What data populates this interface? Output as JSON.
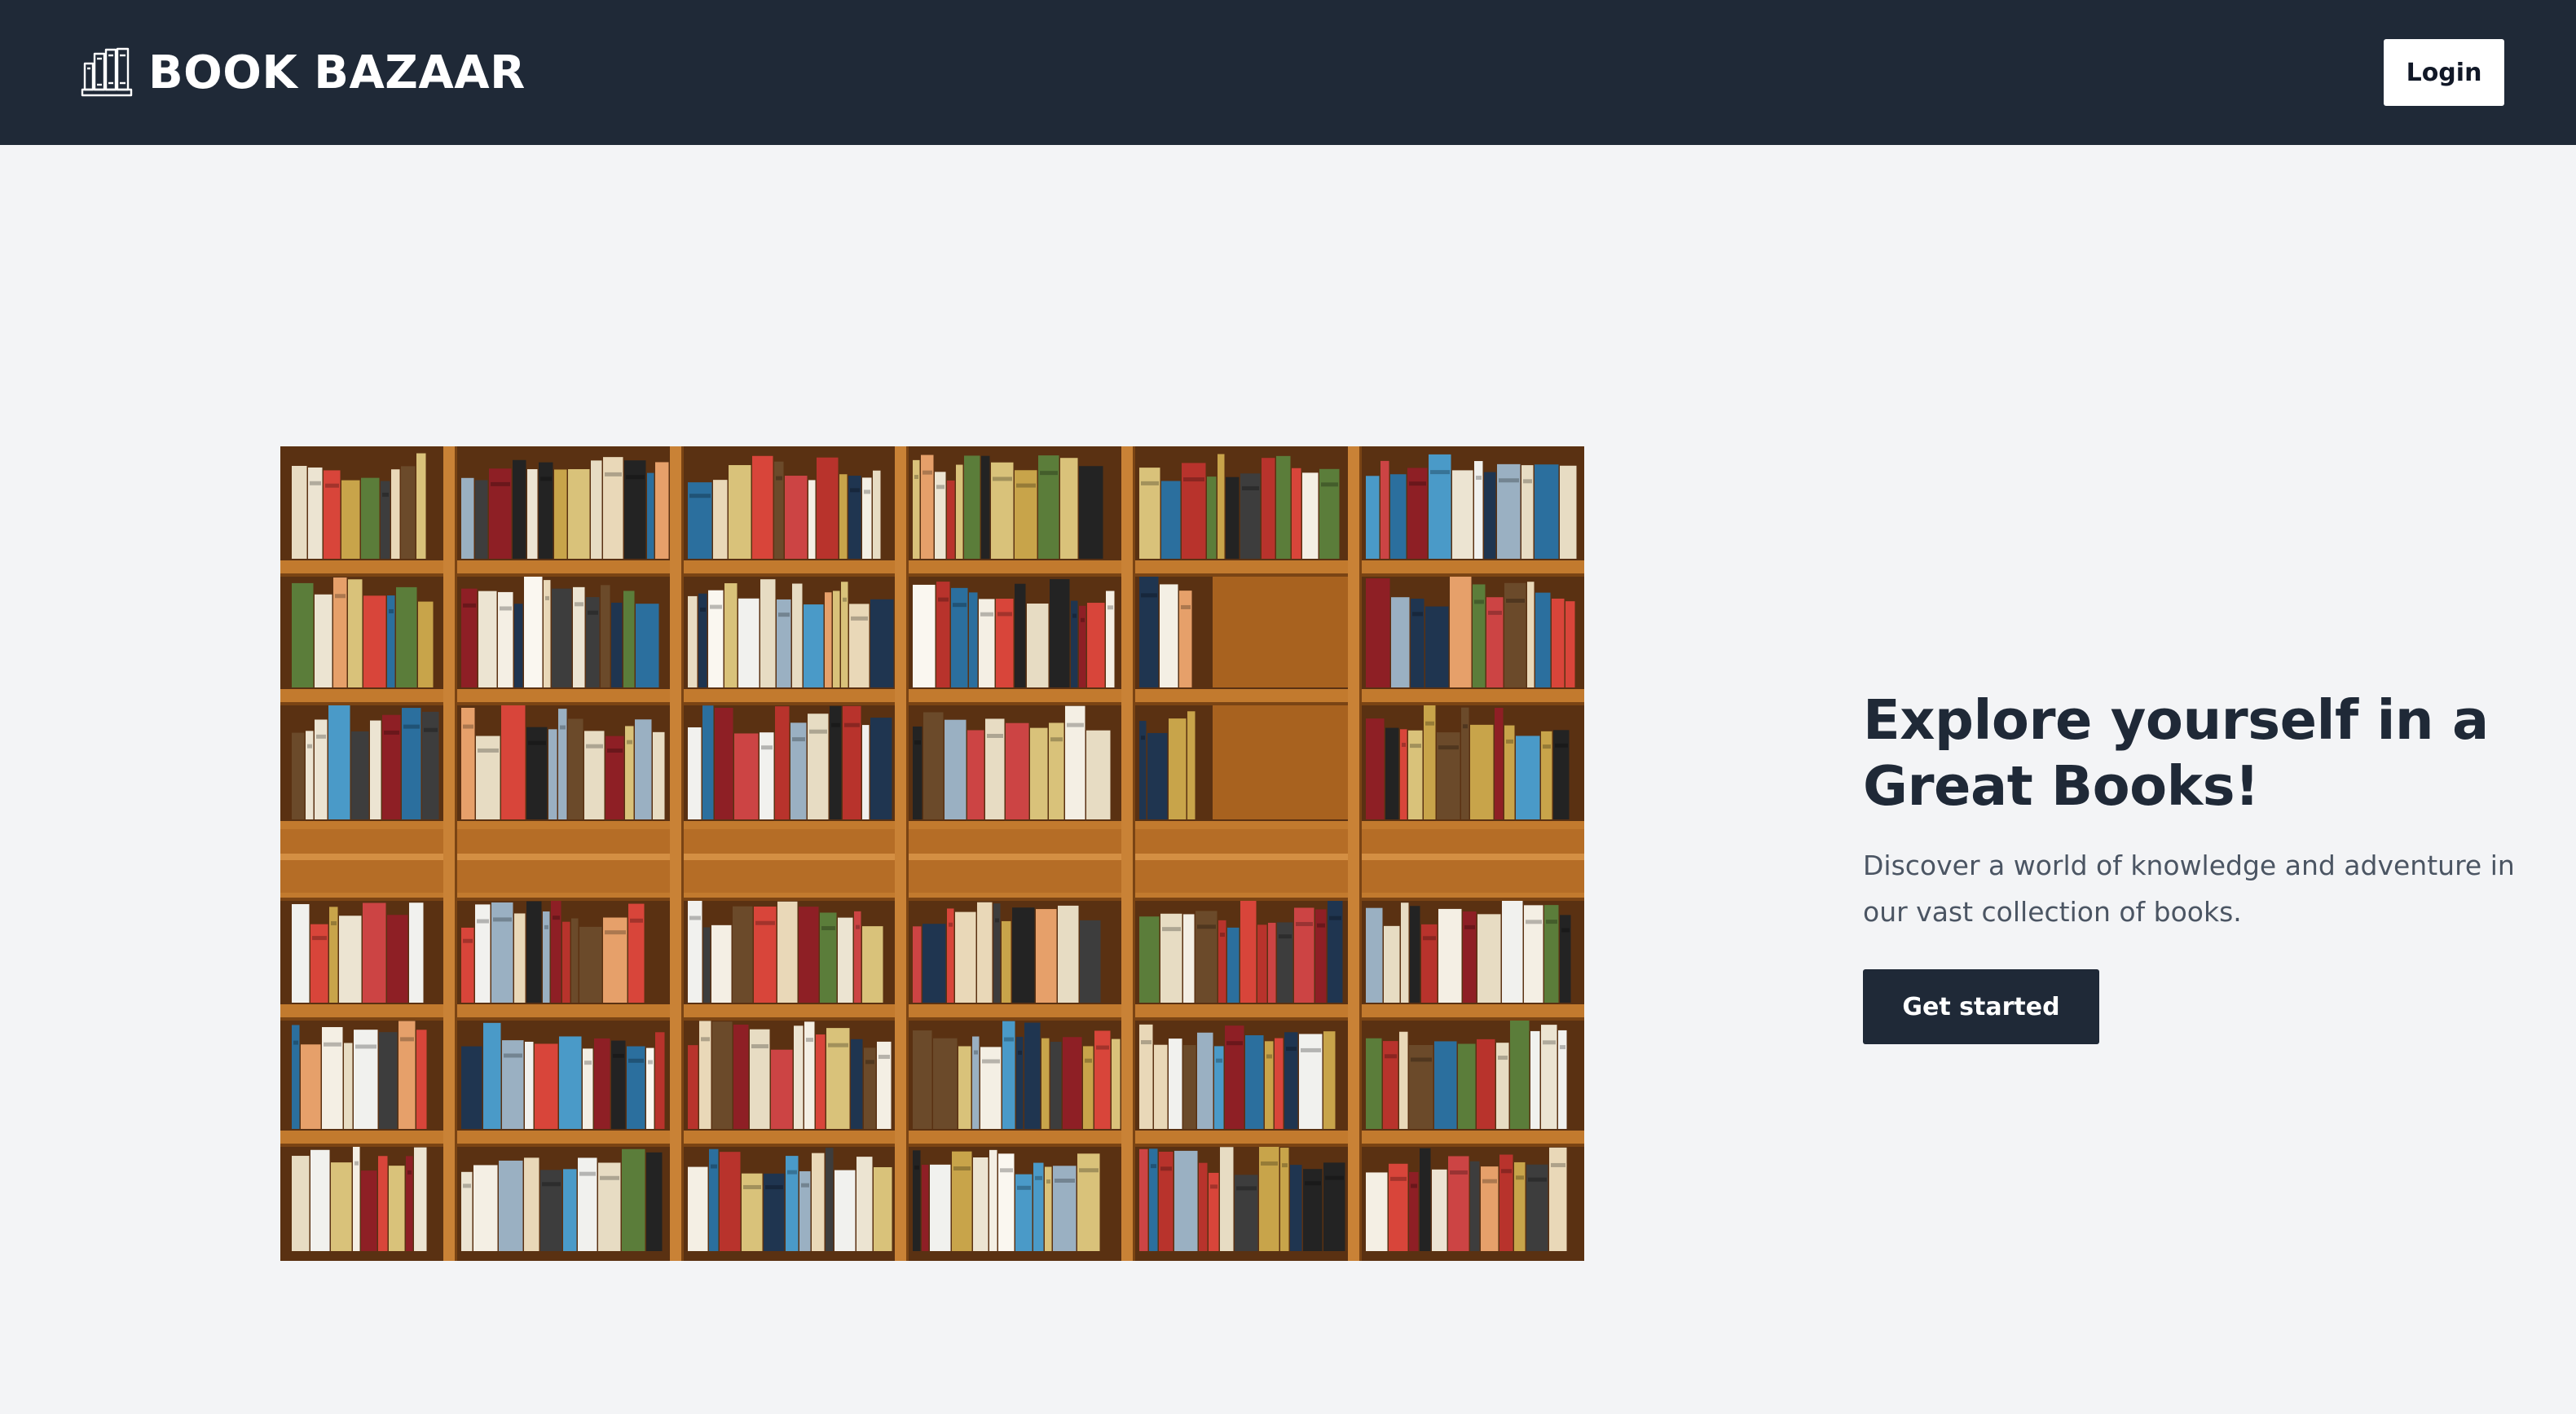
{
  "header": {
    "brand_icon": "bookshelf-icon",
    "brand_name": "BOOK BAZAAR",
    "login_label": "Login",
    "background_color": "#1f2937"
  },
  "hero": {
    "image_subject": "library-bookshelf-photo",
    "title": "Explore yourself in a Great Books!",
    "subtitle": "Discover a world of knowledge and adventure in our vast collection of books.",
    "cta_label": "Get started",
    "accent_color": "#1f2937",
    "page_background": "#f3f4f6"
  }
}
